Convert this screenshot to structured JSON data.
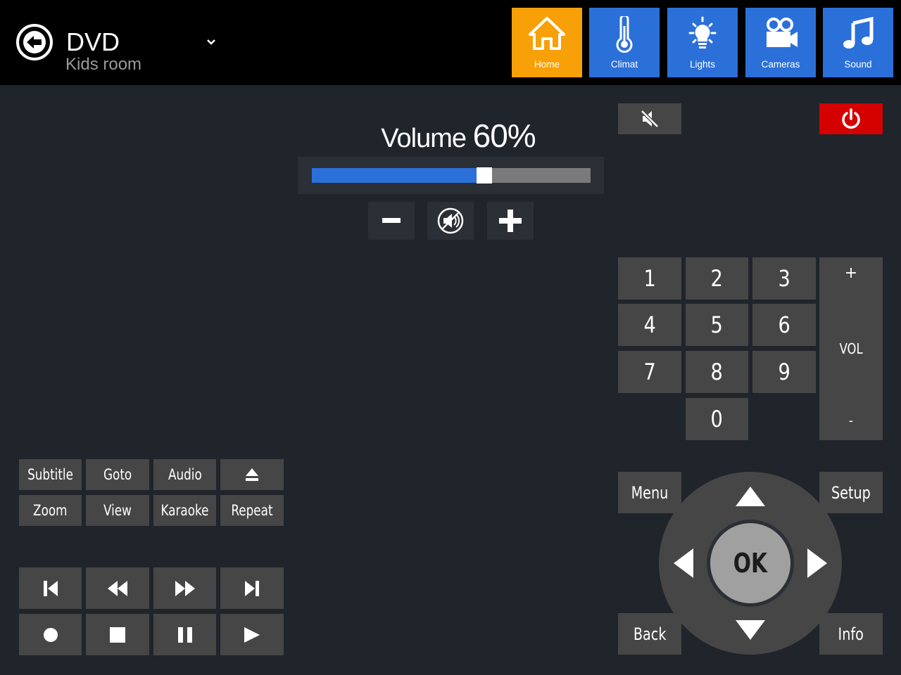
{
  "header": {
    "device": "DVD",
    "room": "Kids room",
    "nav": [
      {
        "label": "Home",
        "icon": "home-icon",
        "active": true
      },
      {
        "label": "Climat",
        "icon": "thermometer-icon",
        "active": false
      },
      {
        "label": "Lights",
        "icon": "lightbulb-icon",
        "active": false
      },
      {
        "label": "Cameras",
        "icon": "camera-icon",
        "active": false
      },
      {
        "label": "Sound",
        "icon": "music-note-icon",
        "active": false
      }
    ]
  },
  "volume": {
    "label": "Volume",
    "value_text": "60%",
    "level": 0.6
  },
  "keypad": {
    "keys": [
      "1",
      "2",
      "3",
      "4",
      "5",
      "6",
      "7",
      "8",
      "9",
      "0"
    ],
    "vol_label": "VOL",
    "vol_plus": "+",
    "vol_minus": "-"
  },
  "navigation": {
    "ok": "OK",
    "menu": "Menu",
    "setup": "Setup",
    "back": "Back",
    "info": "Info"
  },
  "functions": {
    "subtitle": "Subtitle",
    "goto": "Goto",
    "audio": "Audio",
    "zoom": "Zoom",
    "view": "View",
    "karaoke": "Karaoke",
    "repeat": "Repeat"
  },
  "colors": {
    "accent": "#2b70d9",
    "active_tile": "#f7a008",
    "power": "#d50000",
    "button": "#464646",
    "background": "#20242b"
  }
}
